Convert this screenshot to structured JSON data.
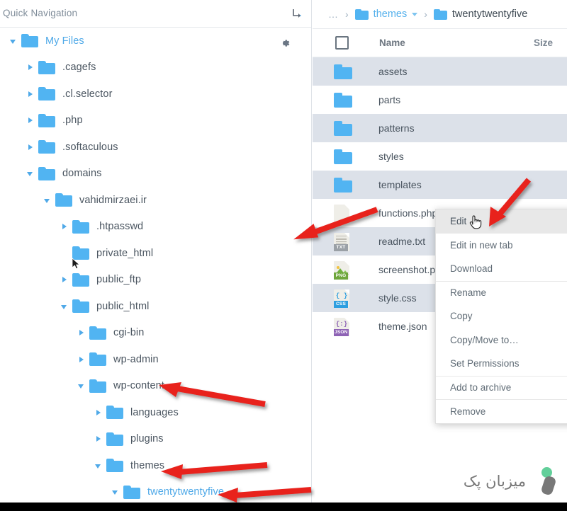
{
  "sidebar": {
    "title": "Quick Navigation",
    "collapse_icon": "arrow-turn-down-right-icon",
    "settings_icon": "gear-icon",
    "tree": [
      {
        "label": "My Files",
        "depth": 0,
        "state": "expanded",
        "accent": true,
        "icon": "folder-icon"
      },
      {
        "label": ".cagefs",
        "depth": 1,
        "state": "collapsed",
        "accent": false,
        "icon": "folder-icon"
      },
      {
        "label": ".cl.selector",
        "depth": 1,
        "state": "collapsed",
        "accent": false,
        "icon": "folder-icon"
      },
      {
        "label": ".php",
        "depth": 1,
        "state": "collapsed",
        "accent": false,
        "icon": "folder-icon"
      },
      {
        "label": ".softaculous",
        "depth": 1,
        "state": "collapsed",
        "accent": false,
        "icon": "folder-icon"
      },
      {
        "label": "domains",
        "depth": 1,
        "state": "expanded",
        "accent": false,
        "icon": "folder-icon"
      },
      {
        "label": "vahidmirzaei.ir",
        "depth": 2,
        "state": "expanded",
        "accent": false,
        "icon": "folder-icon"
      },
      {
        "label": ".htpasswd",
        "depth": 3,
        "state": "collapsed",
        "accent": false,
        "icon": "folder-icon"
      },
      {
        "label": "private_html",
        "depth": 3,
        "state": "leaf",
        "accent": false,
        "icon": "folder-icon"
      },
      {
        "label": "public_ftp",
        "depth": 3,
        "state": "collapsed",
        "accent": false,
        "icon": "folder-icon"
      },
      {
        "label": "public_html",
        "depth": 3,
        "state": "expanded",
        "accent": false,
        "icon": "folder-icon"
      },
      {
        "label": "cgi-bin",
        "depth": 4,
        "state": "collapsed",
        "accent": false,
        "icon": "folder-icon"
      },
      {
        "label": "wp-admin",
        "depth": 4,
        "state": "collapsed",
        "accent": false,
        "icon": "folder-icon"
      },
      {
        "label": "wp-content",
        "depth": 4,
        "state": "expanded",
        "accent": false,
        "icon": "folder-icon"
      },
      {
        "label": "languages",
        "depth": 5,
        "state": "collapsed",
        "accent": false,
        "icon": "folder-icon"
      },
      {
        "label": "plugins",
        "depth": 5,
        "state": "collapsed",
        "accent": false,
        "icon": "folder-icon"
      },
      {
        "label": "themes",
        "depth": 5,
        "state": "expanded",
        "accent": false,
        "icon": "folder-icon"
      },
      {
        "label": "twentytwentyfive",
        "depth": 6,
        "state": "expanded",
        "accent": true,
        "icon": "folder-icon"
      }
    ]
  },
  "breadcrumb": {
    "ellipsis": "…",
    "separator": "›",
    "items": [
      {
        "label": "themes",
        "accent": true,
        "has_chevron": true
      },
      {
        "label": "twentytwentyfive",
        "accent": false,
        "has_chevron": false
      }
    ]
  },
  "file_list": {
    "columns": {
      "name": "Name",
      "size": "Size"
    },
    "select_all_checkbox": "unchecked",
    "rows": [
      {
        "name": "assets",
        "type": "folder",
        "icon": "folder-icon",
        "shaded": true
      },
      {
        "name": "parts",
        "type": "folder",
        "icon": "folder-icon",
        "shaded": false
      },
      {
        "name": "patterns",
        "type": "folder",
        "icon": "folder-icon",
        "shaded": true
      },
      {
        "name": "styles",
        "type": "folder",
        "icon": "folder-icon",
        "shaded": false
      },
      {
        "name": "templates",
        "type": "folder",
        "icon": "folder-icon",
        "shaded": true
      },
      {
        "name": "functions.php",
        "type": "file",
        "icon": "php-file-icon",
        "shaded": false,
        "badge": "",
        "badge_color": "#aaaaaa"
      },
      {
        "name": "readme.txt",
        "type": "file",
        "icon": "txt-file-icon",
        "shaded": true,
        "badge": "TXT",
        "badge_color": "#9aa0a6"
      },
      {
        "name": "screenshot.png",
        "type": "file",
        "icon": "png-file-icon",
        "shaded": false,
        "badge": "PNG",
        "badge_color": "#6fa63c"
      },
      {
        "name": "style.css",
        "type": "file",
        "icon": "css-file-icon",
        "shaded": true,
        "badge": "CSS",
        "badge_color": "#2e9fe0"
      },
      {
        "name": "theme.json",
        "type": "file",
        "icon": "json-file-icon",
        "shaded": false,
        "badge": "JSON",
        "badge_color": "#8e63b5"
      }
    ]
  },
  "context_menu": {
    "target_file": "functions.php",
    "items": [
      {
        "label": "Edit",
        "highlighted": true,
        "group_start": false
      },
      {
        "label": "Edit in new tab",
        "highlighted": false,
        "group_start": false
      },
      {
        "label": "Download",
        "highlighted": false,
        "group_start": false
      },
      {
        "label": "Rename",
        "highlighted": false,
        "group_start": true
      },
      {
        "label": "Copy",
        "highlighted": false,
        "group_start": false
      },
      {
        "label": "Copy/Move to…",
        "highlighted": false,
        "group_start": false
      },
      {
        "label": "Set Permissions",
        "highlighted": false,
        "group_start": false
      },
      {
        "label": "Add to archive",
        "highlighted": false,
        "group_start": true
      },
      {
        "label": "Remove",
        "highlighted": false,
        "group_start": true
      }
    ]
  },
  "annotations": {
    "arrow_color": "#e8201c",
    "arrows": [
      {
        "name": "arrow-to-wp-content",
        "points_to": "wp-content"
      },
      {
        "name": "arrow-to-themes",
        "points_to": "themes"
      },
      {
        "name": "arrow-to-twentytwentyfive",
        "points_to": "twentytwentyfive"
      },
      {
        "name": "arrow-to-functions-php",
        "points_to": "functions.php"
      },
      {
        "name": "arrow-to-edit",
        "points_to": "Edit"
      }
    ]
  },
  "watermark": {
    "text": "میزبان پک",
    "dot_color": "#62cf9a",
    "bar_color": "#787878"
  },
  "colors": {
    "folder_blue": "#51b4f2",
    "accent_link": "#4fa9e8",
    "row_shade": "#dce1e9",
    "text_primary": "#4a5560",
    "text_muted": "#7f8c99"
  }
}
